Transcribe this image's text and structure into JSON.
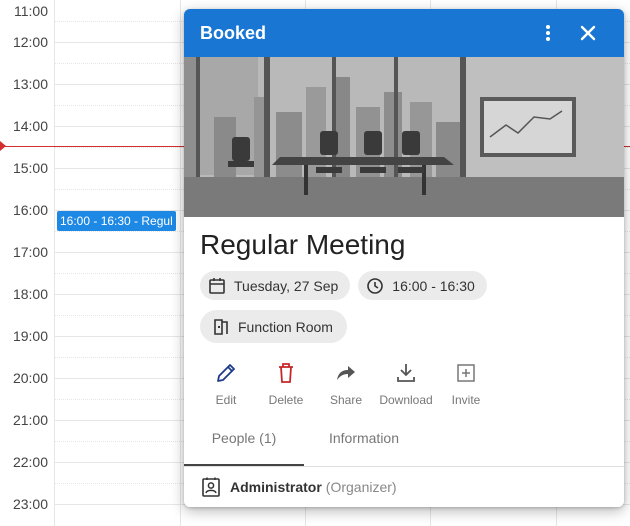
{
  "calendar": {
    "hours": [
      "11:00",
      "12:00",
      "13:00",
      "14:00",
      "15:00",
      "16:00",
      "17:00",
      "18:00",
      "19:00",
      "20:00",
      "21:00",
      "22:00",
      "23:00"
    ],
    "event_chip": "16:00 - 16:30 - Regul",
    "now_color": "#d32f2f"
  },
  "popup": {
    "status": "Booked",
    "header_color": "#1976d2",
    "more_icon": "more-vert-icon",
    "close_icon": "close-icon",
    "title": "Regular Meeting",
    "date": "Tuesday, 27 Sep",
    "time": "16:00 - 16:30",
    "room": "Function Room",
    "actions": [
      {
        "label": "Edit",
        "icon": "pencil-icon",
        "color": "#1e3a8a"
      },
      {
        "label": "Delete",
        "icon": "trash-icon",
        "color": "#c62828"
      },
      {
        "label": "Share",
        "icon": "share-icon",
        "color": "#555555"
      },
      {
        "label": "Download",
        "icon": "download-icon",
        "color": "#555555"
      },
      {
        "label": "Invite",
        "icon": "invite-icon",
        "color": "#777777"
      }
    ],
    "tabs": [
      "People (1)",
      "Information"
    ],
    "people": [
      {
        "name": "Administrator",
        "role": "(Organizer)"
      }
    ]
  }
}
